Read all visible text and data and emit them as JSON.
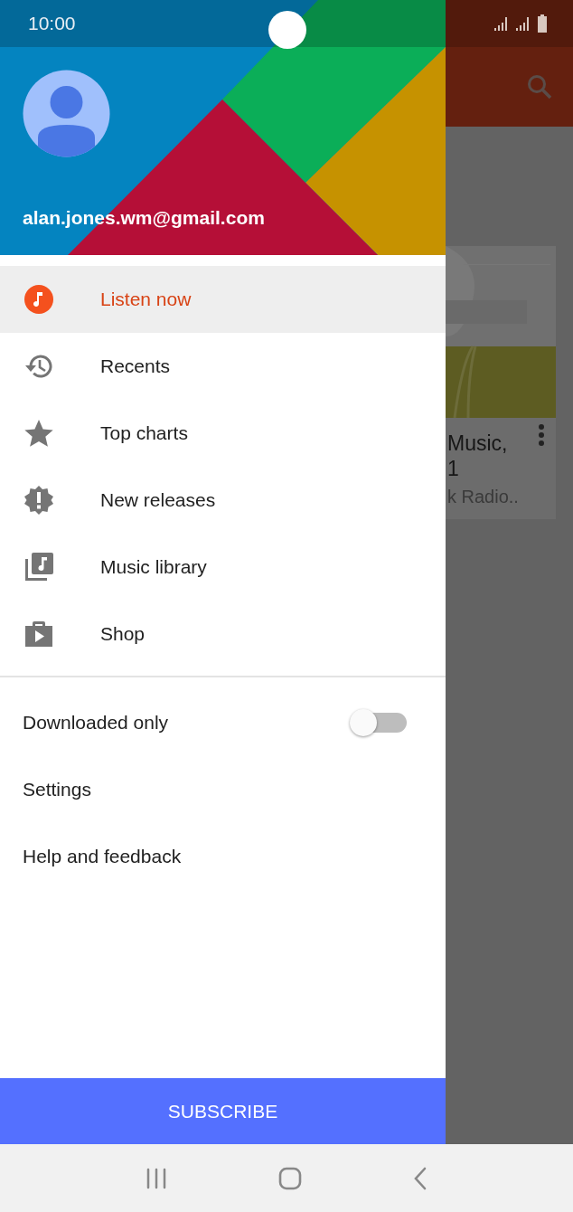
{
  "status_bar": {
    "time": "10:00"
  },
  "background": {
    "album_card": {
      "title_lines": [
        "Music,",
        "1"
      ],
      "subtitle": "k Radio.."
    }
  },
  "drawer": {
    "account": {
      "email": "alan.jones.wm@gmail.com"
    },
    "nav_items": [
      {
        "kind": "listen",
        "label": "Listen now",
        "selected": true
      },
      {
        "kind": "recents",
        "label": "Recents",
        "selected": false
      },
      {
        "kind": "charts",
        "label": "Top charts",
        "selected": false
      },
      {
        "kind": "releases",
        "label": "New releases",
        "selected": false
      },
      {
        "kind": "library",
        "label": "Music library",
        "selected": false
      },
      {
        "kind": "shop",
        "label": "Shop",
        "selected": false
      }
    ],
    "settings_items": [
      {
        "kind": "toggle",
        "label": "Downloaded only",
        "on": false
      },
      {
        "kind": "link",
        "label": "Settings"
      },
      {
        "kind": "link",
        "label": "Help and feedback"
      }
    ],
    "subscribe_button": "SUBSCRIBE"
  }
}
